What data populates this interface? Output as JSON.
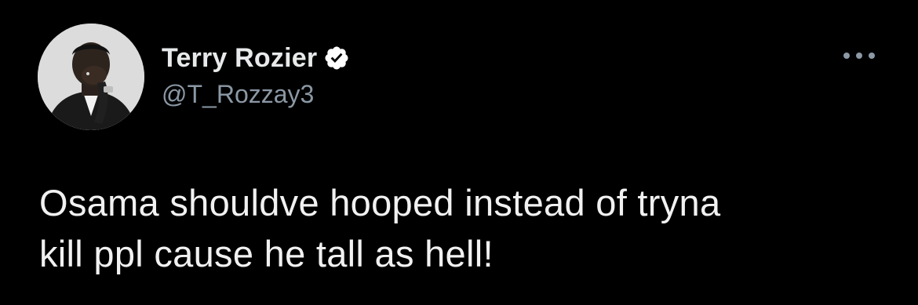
{
  "tweet": {
    "author": {
      "display_name": "Terry Rozier",
      "handle": "@T_Rozzay3",
      "verified": true,
      "avatar_icon": "profile-photo"
    },
    "more_icon": "more-horizontal-icon",
    "text": "Osama shouldve hooped instead of tryna\nkill ppl cause he tall as hell!"
  },
  "colors": {
    "background": "#000000",
    "primary_text": "#e7e9ea",
    "secondary_text": "#8b98a5",
    "verified_badge": "#ffffff"
  }
}
